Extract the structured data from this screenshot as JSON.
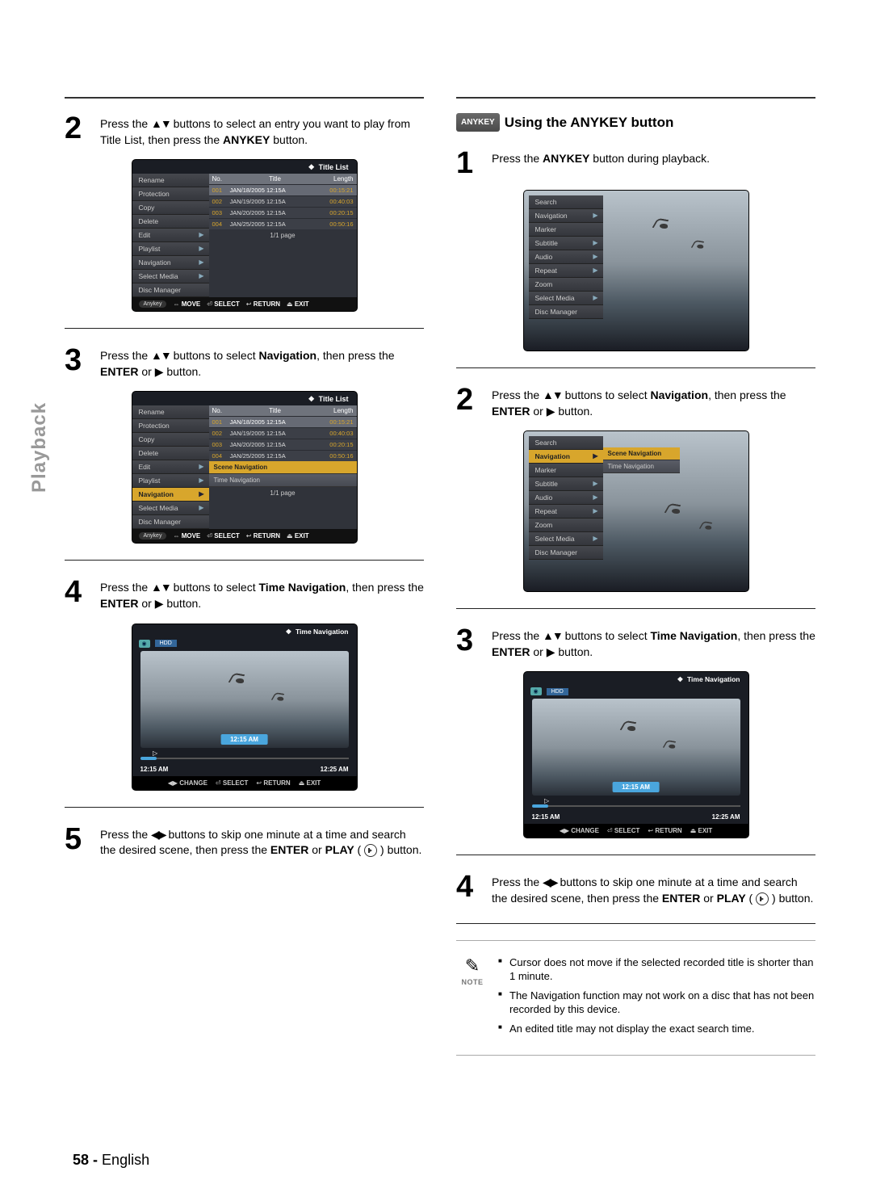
{
  "sidebar_label": "Playback",
  "footer": {
    "page": "58 -",
    "lang": "English"
  },
  "left": {
    "step2": {
      "t1": "Press the ",
      "sym": "▲▼",
      "t2": " buttons to select an entry you want to play from Title List, then press the ",
      "b1": "ANYKEY",
      "t3": " button."
    },
    "step3": {
      "t1": "Press the ",
      "sym": "▲▼",
      "t2": " buttons to select ",
      "b1": "Navigation",
      "t3": ", then press the ",
      "b2": "ENTER",
      "t4": " or ",
      "sym2": "▶",
      "t5": " button."
    },
    "step4": {
      "t1": "Press the ",
      "sym": "▲▼",
      "t2": " buttons to select ",
      "b1": "Time Navigation",
      "t3": ", then press the ",
      "b2": "ENTER",
      "t4": " or ",
      "sym2": "▶",
      "t5": " button."
    },
    "step5": {
      "t1": "Press the ",
      "sym": "◀▶",
      "t2": " buttons to skip one minute at a time and search the desired scene, then press the ",
      "b1": "ENTER",
      "t3": " or ",
      "b2": "PLAY",
      "t4": " ( ",
      "t5": " ) button."
    }
  },
  "right": {
    "badge": "ANYKEY",
    "title": "Using the ANYKEY button",
    "step1": {
      "t1": "Press the ",
      "b1": "ANYKEY",
      "t2": " button during playback."
    },
    "step2": {
      "t1": "Press the ",
      "sym": "▲▼",
      "t2": " buttons to select ",
      "b1": "Navigation",
      "t3": ", then press the ",
      "b2": "ENTER",
      "t4": " or ",
      "sym2": "▶",
      "t5": " button."
    },
    "step3": {
      "t1": "Press the ",
      "sym": "▲▼",
      "t2": " buttons to select ",
      "b1": "Time Navigation",
      "t3": ", then press the ",
      "b2": "ENTER",
      "t4": " or ",
      "sym2": "▶",
      "t5": " button."
    },
    "step4": {
      "t1": "Press the ",
      "sym": "◀▶",
      "t2": " buttons to skip one minute at a time and search the desired scene, then press the ",
      "b1": "ENTER",
      "t3": " or ",
      "b2": "PLAY",
      "t4": " ( ",
      "t5": " ) button."
    },
    "note_label": "NOTE",
    "notes": [
      "Cursor does not move if the selected recorded title is shorter than 1 minute.",
      "The Navigation function may not work on a disc that has not been recorded by this device.",
      "An edited title may not display the exact search time."
    ]
  },
  "osd": {
    "title_list": "Title List",
    "headers": {
      "no": "No.",
      "title": "Title",
      "len": "Length"
    },
    "side_items": [
      "Rename",
      "Protection",
      "Copy",
      "Delete",
      "Edit",
      "Playlist",
      "Navigation",
      "Select Media",
      "Disc Manager"
    ],
    "side_arrows": {
      "Edit": true,
      "Playlist": true,
      "Navigation": true,
      "Select Media": true
    },
    "rows": [
      {
        "no": "001",
        "title": "JAN/18/2005 12:15A",
        "len": "00:15:21"
      },
      {
        "no": "002",
        "title": "JAN/19/2005 12:15A",
        "len": "00:40:03"
      },
      {
        "no": "003",
        "title": "JAN/20/2005 12:15A",
        "len": "00:20:15"
      },
      {
        "no": "004",
        "title": "JAN/25/2005 12:15A",
        "len": "00:50:16"
      }
    ],
    "page": "1/1 page",
    "foot": {
      "anykey": "Anykey",
      "move": "MOVE",
      "select": "SELECT",
      "ret": "RETURN",
      "exit": "EXIT",
      "change": "CHANGE"
    },
    "sym": {
      "diamond": "❖",
      "move": "⇔",
      "sel": "⏎",
      "ret": "↩",
      "exit": "⏏",
      "lr": "◀▶"
    },
    "nav_sub": [
      "Scene Navigation",
      "Time Navigation"
    ],
    "play_menu": [
      "Search",
      "Navigation",
      "Marker",
      "Subtitle",
      "Audio",
      "Repeat",
      "Zoom",
      "Select Media",
      "Disc Manager"
    ],
    "play_arrows": {
      "Navigation": true,
      "Subtitle": true,
      "Audio": true,
      "Repeat": true,
      "Select Media": true
    },
    "time_nav": "Time Navigation",
    "hdd": "HDD",
    "t_start": "12:15 AM",
    "t_end": "12:25 AM",
    "t_cur": "12:15 AM"
  }
}
